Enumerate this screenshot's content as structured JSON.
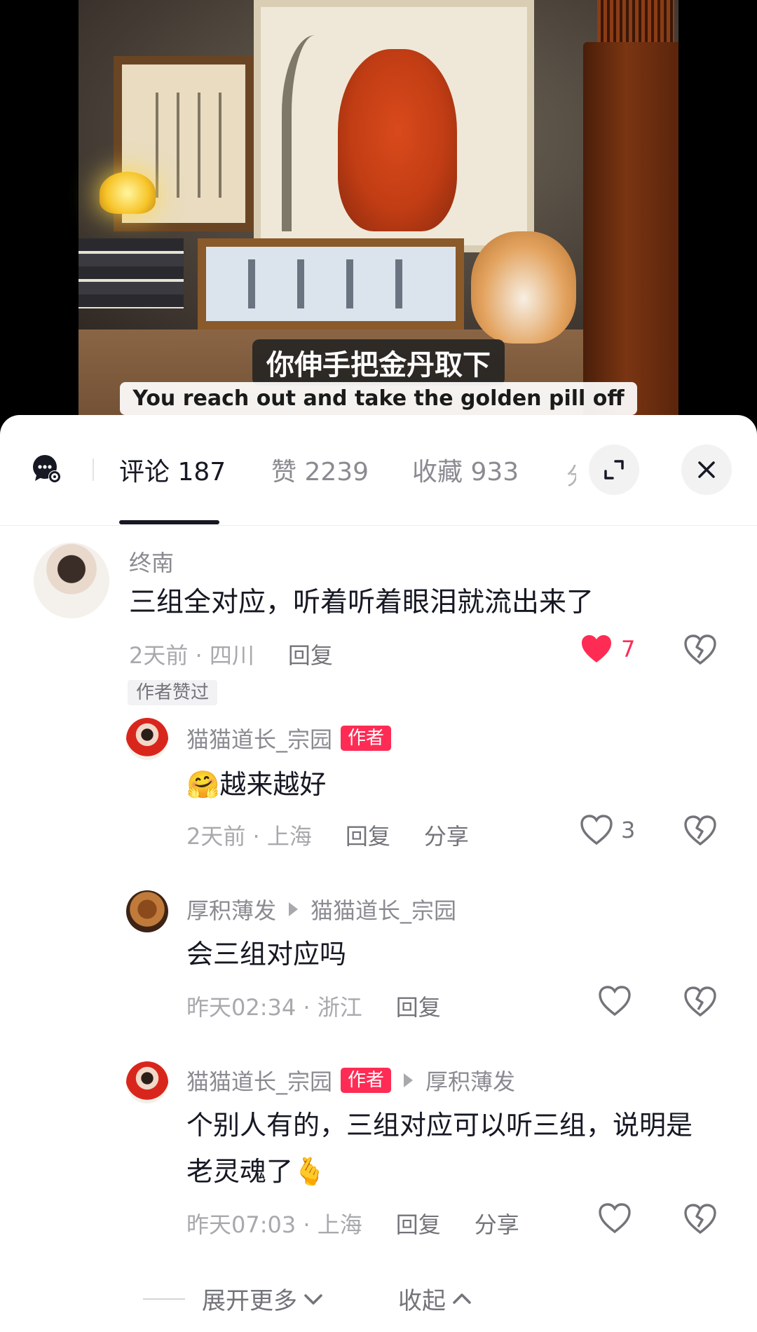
{
  "video": {
    "subtitle_cn": "你伸手把金丹取下",
    "subtitle_en": "You reach out and take the golden pill off"
  },
  "tabs": {
    "settings_icon": "chat-settings-icon",
    "items": [
      {
        "label": "评论 187",
        "active": true
      },
      {
        "label": "赞 2239",
        "active": false
      },
      {
        "label": "收藏 933",
        "active": false
      }
    ],
    "expand_icon": "expand-icon",
    "close_icon": "close-icon"
  },
  "comments": [
    {
      "user": "终南",
      "text": "三组全对应，听着听着眼泪就流出来了",
      "meta": "2天前 · 四川",
      "reply": "回复",
      "likes": "7",
      "liked": true,
      "author_liked_badge": "作者赞过"
    },
    {
      "user": "猫猫道长_宗园",
      "author_tag": "作者",
      "text": "越来越好",
      "emoji": "🤗",
      "meta": "2天前 · 上海",
      "reply": "回复",
      "share": "分享",
      "likes": "3"
    },
    {
      "user": "厚积薄发",
      "reply_to": "猫猫道长_宗园",
      "text": "会三组对应吗",
      "meta": "昨天02:34 · 浙江",
      "reply": "回复"
    },
    {
      "user": "猫猫道长_宗园",
      "author_tag": "作者",
      "reply_to": "厚积薄发",
      "text_line1": "个别人有的，三组对应可以听三组，说明是",
      "text_line2": "老灵魂了",
      "emoji": "🫰",
      "meta": "昨天07:03 · 上海",
      "reply": "回复",
      "share": "分享"
    }
  ],
  "footer": {
    "expand_more": "展开更多",
    "collapse": "收起"
  },
  "colors": {
    "accent": "#fe2c55",
    "text_primary": "#161823",
    "text_secondary": "#8a8b91"
  }
}
